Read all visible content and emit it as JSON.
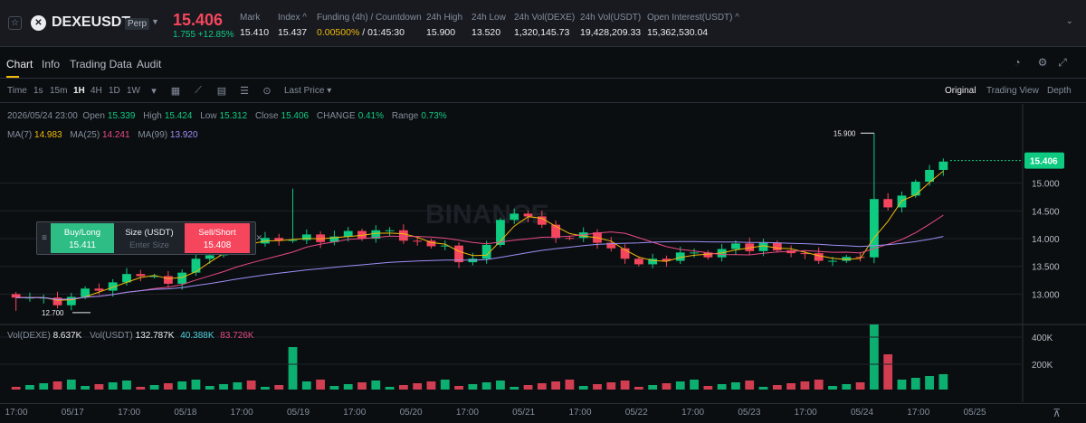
{
  "header": {
    "symbol": "DEXEUSDT",
    "badge": "Perp",
    "last_price": "15.406",
    "change": "1.755 +12.85%",
    "stats": [
      {
        "label": "Mark",
        "value": "15.410"
      },
      {
        "label": "Index",
        "value": "15.437"
      },
      {
        "label": "Funding (4h) / Countdown",
        "rate": "0.00500%",
        "countdown": "01:45:30"
      },
      {
        "label": "24h High",
        "value": "15.900"
      },
      {
        "label": "24h Low",
        "value": "13.520"
      },
      {
        "label": "24h Vol(DEXE)",
        "value": "1,320,145.73"
      },
      {
        "label": "24h Vol(USDT)",
        "value": "19,428,209.33"
      },
      {
        "label": "Open Interest(USDT)",
        "value": "15,362,530.04"
      }
    ]
  },
  "tabs": [
    "Chart",
    "Info",
    "Trading Data",
    "Audit"
  ],
  "toolbar": {
    "intervals": [
      "Time",
      "1s",
      "15m",
      "1H",
      "4H",
      "1D",
      "1W"
    ],
    "active_interval": "1H",
    "price_type": "Last Price",
    "views": [
      "Original",
      "Trading View",
      "Depth"
    ],
    "active_view": "Original"
  },
  "legend": {
    "date": "2026/05/24 23:00",
    "open_label": "Open",
    "open": "15.339",
    "high_label": "High",
    "high": "15.424",
    "low_label": "Low",
    "low": "15.312",
    "close_label": "Close",
    "close": "15.406",
    "change_label": "CHANGE",
    "change": "0.41%",
    "range_label": "Range",
    "range": "0.73%",
    "ma7_label": "MA(7)",
    "ma7": "14.983",
    "ma25_label": "MA(25)",
    "ma25": "14.241",
    "ma99_label": "MA(99)",
    "ma99": "13.920"
  },
  "volume_legend": {
    "label1": "Vol(DEXE)",
    "v1": "8.637K",
    "label2": "Vol(USDT)",
    "v2": "132.787K",
    "v3": "40.388K",
    "v4": "83.726K"
  },
  "order_widget": {
    "buy_label": "Buy/Long",
    "buy_price": "15.411",
    "size_label": "Size (USDT)",
    "size_placeholder": "Enter Size",
    "sell_label": "Sell/Short",
    "sell_price": "15.408"
  },
  "watermark": "BINANCE",
  "colors": {
    "up": "#0ecb81",
    "down": "#f6465d",
    "ma7": "#f0b90b",
    "ma25": "#e84a85",
    "ma99": "#9d8ff5",
    "accent": "#f0b90b"
  },
  "chart_data": {
    "type": "candlestick",
    "price_ticks": [
      "15.000",
      "14.500",
      "14.000",
      "13.500",
      "13.000"
    ],
    "volume_ticks": [
      "400K",
      "200K"
    ],
    "x_labels": [
      "17:00",
      "05/17",
      "17:00",
      "05/18",
      "17:00",
      "05/19",
      "17:00",
      "05/20",
      "17:00",
      "05/21",
      "17:00",
      "05/22",
      "17:00",
      "05/23",
      "17:00",
      "05/24",
      "17:00",
      "05/25"
    ],
    "current_price": "15.406",
    "high_marker": "15.900",
    "low_marker": "12.700",
    "ylim": [
      12.6,
      16.1
    ],
    "close_path": [
      13.0,
      12.95,
      12.9,
      12.85,
      12.95,
      13.05,
      13.1,
      13.2,
      13.3,
      13.35,
      13.3,
      13.25,
      13.4,
      13.6,
      13.75,
      13.85,
      13.9,
      13.95,
      14.0,
      13.9,
      14.0,
      14.05,
      14.0,
      14.05,
      14.1,
      14.05,
      14.15,
      14.1,
      14.0,
      13.95,
      13.8,
      13.9,
      13.55,
      13.7,
      13.9,
      14.3,
      14.5,
      14.4,
      14.2,
      14.05,
      14.0,
      14.05,
      13.95,
      13.8,
      13.7,
      13.55,
      13.6,
      13.65,
      13.75,
      13.7,
      13.7,
      13.8,
      13.85,
      13.8,
      13.9,
      13.85,
      13.75,
      13.7,
      13.65,
      13.6,
      13.62,
      13.7,
      14.7,
      14.5,
      14.8,
      15.0,
      15.3,
      15.4
    ]
  }
}
